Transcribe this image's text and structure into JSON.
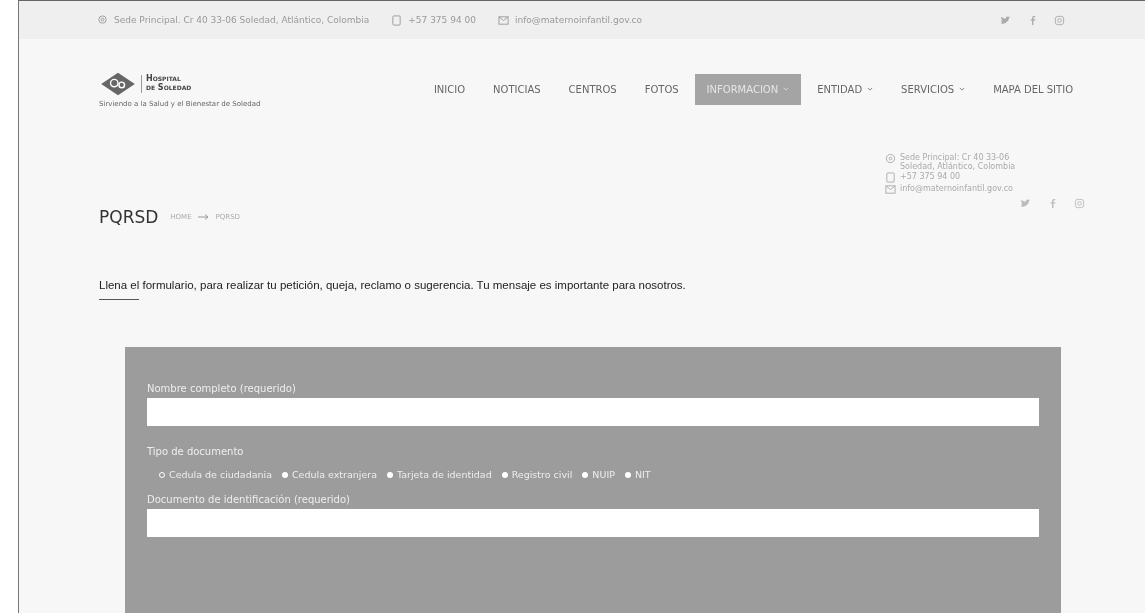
{
  "top_bar": {
    "address": "Sede Principal. Cr 40 33-06 Soledad, Atlántico, Colombia",
    "phone": "+57 375 94 00",
    "email": "info@maternoinfantil.gov.co"
  },
  "logo": {
    "name_line_1": "Hospital",
    "name_line_2": "de Soledad",
    "tagline": "Sirviendo a la Salud y el Bienestar de Soledad"
  },
  "nav": [
    {
      "label": "INICIO",
      "selected": false,
      "dropdown": false
    },
    {
      "label": "NOTICIAS",
      "selected": false,
      "dropdown": false
    },
    {
      "label": "CENTROS",
      "selected": false,
      "dropdown": false
    },
    {
      "label": "FOTOS",
      "selected": false,
      "dropdown": false
    },
    {
      "label": "INFORMACION",
      "selected": true,
      "dropdown": true
    },
    {
      "label": "ENTIDAD",
      "selected": false,
      "dropdown": true
    },
    {
      "label": "SERVICIOS",
      "selected": false,
      "dropdown": true
    },
    {
      "label": "MAPA DEL SITIO",
      "selected": false,
      "dropdown": false
    }
  ],
  "page_title": "PQRSD",
  "breadcrumb": [
    "HOME",
    "PQRSD"
  ],
  "side_contact": {
    "address": "Sede Principal: Cr 40 33-06 Soledad, Atlántico, Colombia",
    "phone": "+57 375 94 00",
    "email": "info@maternoinfantil.gov.co"
  },
  "intro": "Llena el formulario, para realizar tu petición, queja, reclamo o sugerencia. Tu mensaje es importante para nosotros.",
  "form": {
    "name_label": "Nombre completo (requerido)",
    "doc_type_label": "Tipo de documento",
    "doc_types": [
      {
        "label": "Cedula de ciudadania",
        "selected": true
      },
      {
        "label": "Cedula extranjera",
        "selected": false
      },
      {
        "label": "Tarjeta de identidad",
        "selected": false
      },
      {
        "label": "Registro civil",
        "selected": false
      },
      {
        "label": "NUIP",
        "selected": false
      },
      {
        "label": "NIT",
        "selected": false
      }
    ],
    "doc_number_label": "Documento de identificación (requerido)"
  }
}
